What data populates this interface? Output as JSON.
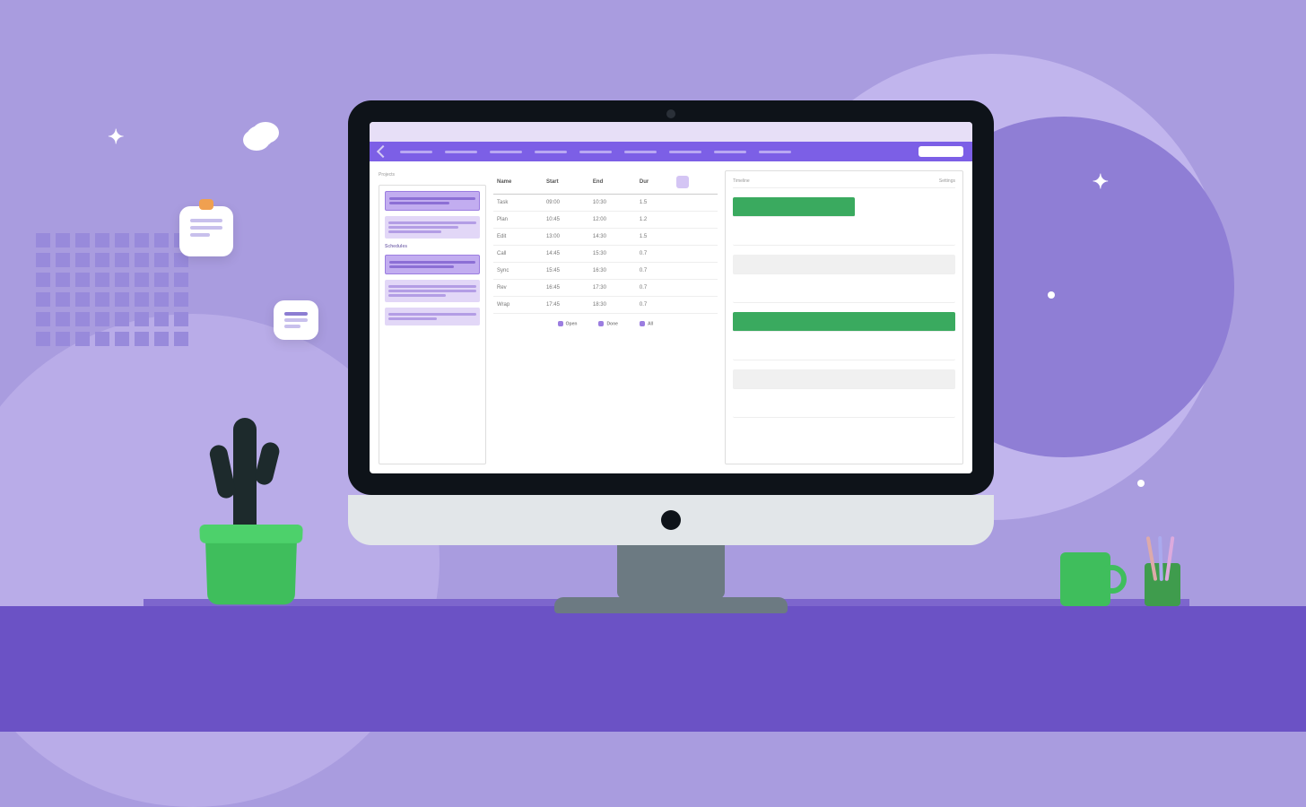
{
  "toolbar": {
    "button": " "
  },
  "sidebar": {
    "title": "Projects",
    "section_label": "Schedules",
    "blocks": [
      {
        "title": ""
      },
      {
        "title": ""
      },
      {
        "title": ""
      },
      {
        "title": ""
      },
      {
        "title": ""
      }
    ]
  },
  "table": {
    "headers": [
      "Name",
      "Start",
      "End",
      "Dur"
    ],
    "rows": [
      [
        "Task",
        "09:00",
        "10:30",
        "1.5"
      ],
      [
        "Plan",
        "10:45",
        "12:00",
        "1.2"
      ],
      [
        "Edit",
        "13:00",
        "14:30",
        "1.5"
      ],
      [
        "Call",
        "14:45",
        "15:30",
        "0.7"
      ],
      [
        "Sync",
        "15:45",
        "16:30",
        "0.7"
      ],
      [
        "Rev",
        "16:45",
        "17:30",
        "0.7"
      ],
      [
        "Wrap",
        "17:45",
        "18:30",
        "0.7"
      ]
    ],
    "footer": [
      "Open",
      "Done",
      "All"
    ]
  },
  "right": {
    "left_label": "Timeline",
    "right_label": "Settings"
  }
}
